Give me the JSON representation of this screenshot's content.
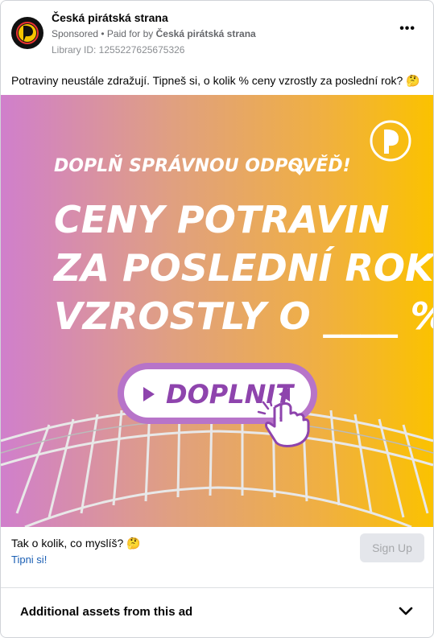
{
  "header": {
    "page_name": "Česká pirátská strana",
    "sponsored": "Sponsored",
    "paid_for_prefix": " • Paid for by ",
    "paid_for_by": "Česká pirátská strana",
    "library_id": "Library ID: 1255227625675326",
    "more_glyph": "•••"
  },
  "post": {
    "text": "Potraviny neustále zdražují. Tipneš si, o kolik % ceny vzrostly za poslední rok? 🤔"
  },
  "creative": {
    "tagline": "DOPLŇ SPRÁVNOU ODPOVĚĎ!",
    "line1": "CENY POTRAVIN",
    "line2": "ZA POSLEDNÍ ROK",
    "line3": "VZROSTLY O ____ %.",
    "button_label": "DOPLNIT"
  },
  "cta": {
    "headline": "Tak o kolik, co myslíš? 🤔",
    "link": "Tipni si!",
    "button": "Sign Up"
  },
  "assets": {
    "label": "Additional assets from this ad"
  }
}
